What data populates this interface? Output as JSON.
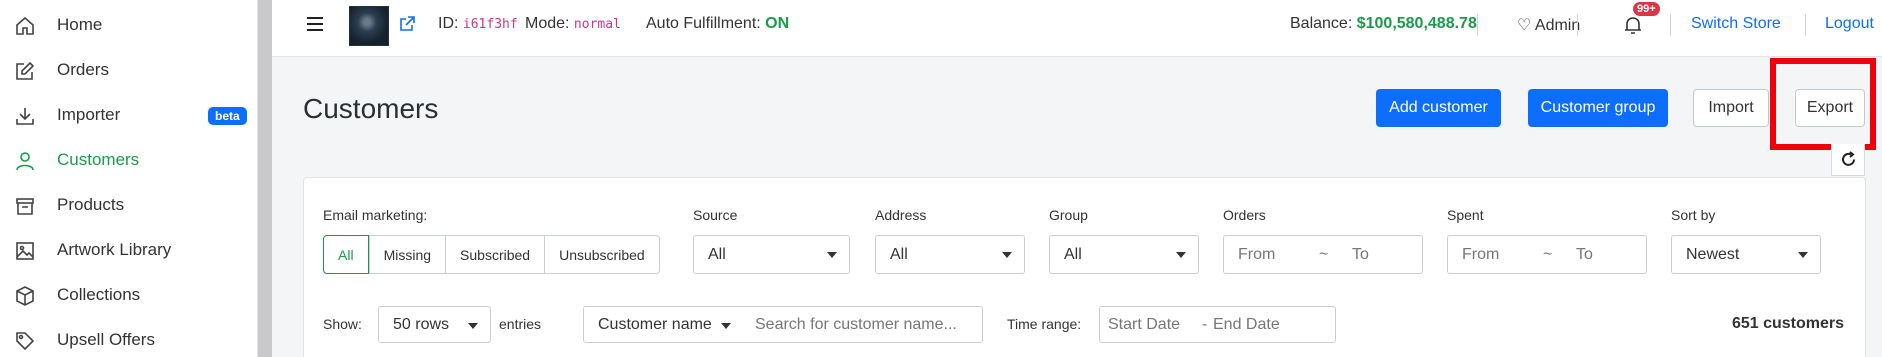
{
  "sidebar": {
    "items": [
      {
        "label": "Home",
        "icon": "home-icon",
        "active": false
      },
      {
        "label": "Orders",
        "icon": "edit-icon",
        "active": false
      },
      {
        "label": "Importer",
        "icon": "download-icon",
        "active": false,
        "badge": "beta"
      },
      {
        "label": "Customers",
        "icon": "user-icon",
        "active": true
      },
      {
        "label": "Products",
        "icon": "archive-icon",
        "active": false
      },
      {
        "label": "Artwork Library",
        "icon": "image-icon",
        "active": false
      },
      {
        "label": "Collections",
        "icon": "box-icon",
        "active": false
      },
      {
        "label": "Upsell Offers",
        "icon": "tag-icon",
        "active": false
      }
    ]
  },
  "topbar": {
    "id_label": "ID:",
    "id_value": "i61f3hf",
    "mode_label": "Mode:",
    "mode_value": "normal",
    "auto_label": "Auto Fulfillment:",
    "auto_value": "ON",
    "balance_label": "Balance:",
    "balance_value": "$100,580,488.78",
    "admin_label": "Admin",
    "notif_count": "99+",
    "switch_store": "Switch Store",
    "logout": "Logout"
  },
  "page": {
    "title": "Customers",
    "add_customer": "Add customer",
    "customer_group": "Customer group",
    "import": "Import",
    "export": "Export"
  },
  "filters": {
    "email_label": "Email marketing:",
    "email_options": [
      "All",
      "Missing",
      "Subscribed",
      "Unsubscribed"
    ],
    "email_selected": "All",
    "source_label": "Source",
    "source_value": "All",
    "address_label": "Address",
    "address_value": "All",
    "group_label": "Group",
    "group_value": "All",
    "orders_label": "Orders",
    "orders_from": "From",
    "orders_sep": "~",
    "orders_to": "To",
    "spent_label": "Spent",
    "spent_from": "From",
    "spent_sep": "~",
    "spent_to": "To",
    "sort_label": "Sort by",
    "sort_value": "Newest",
    "show_label": "Show:",
    "rows_value": "50 rows",
    "entries_label": "entries",
    "search_field": "Customer name",
    "search_placeholder": "Search for customer name...",
    "time_label": "Time range:",
    "start_date": "Start Date",
    "date_sep": "-",
    "end_date": "End Date",
    "count": "651 customers"
  },
  "colors": {
    "primary": "#0d6efd",
    "active_green": "#1a9b4a",
    "highlight_red": "#f0000b"
  }
}
